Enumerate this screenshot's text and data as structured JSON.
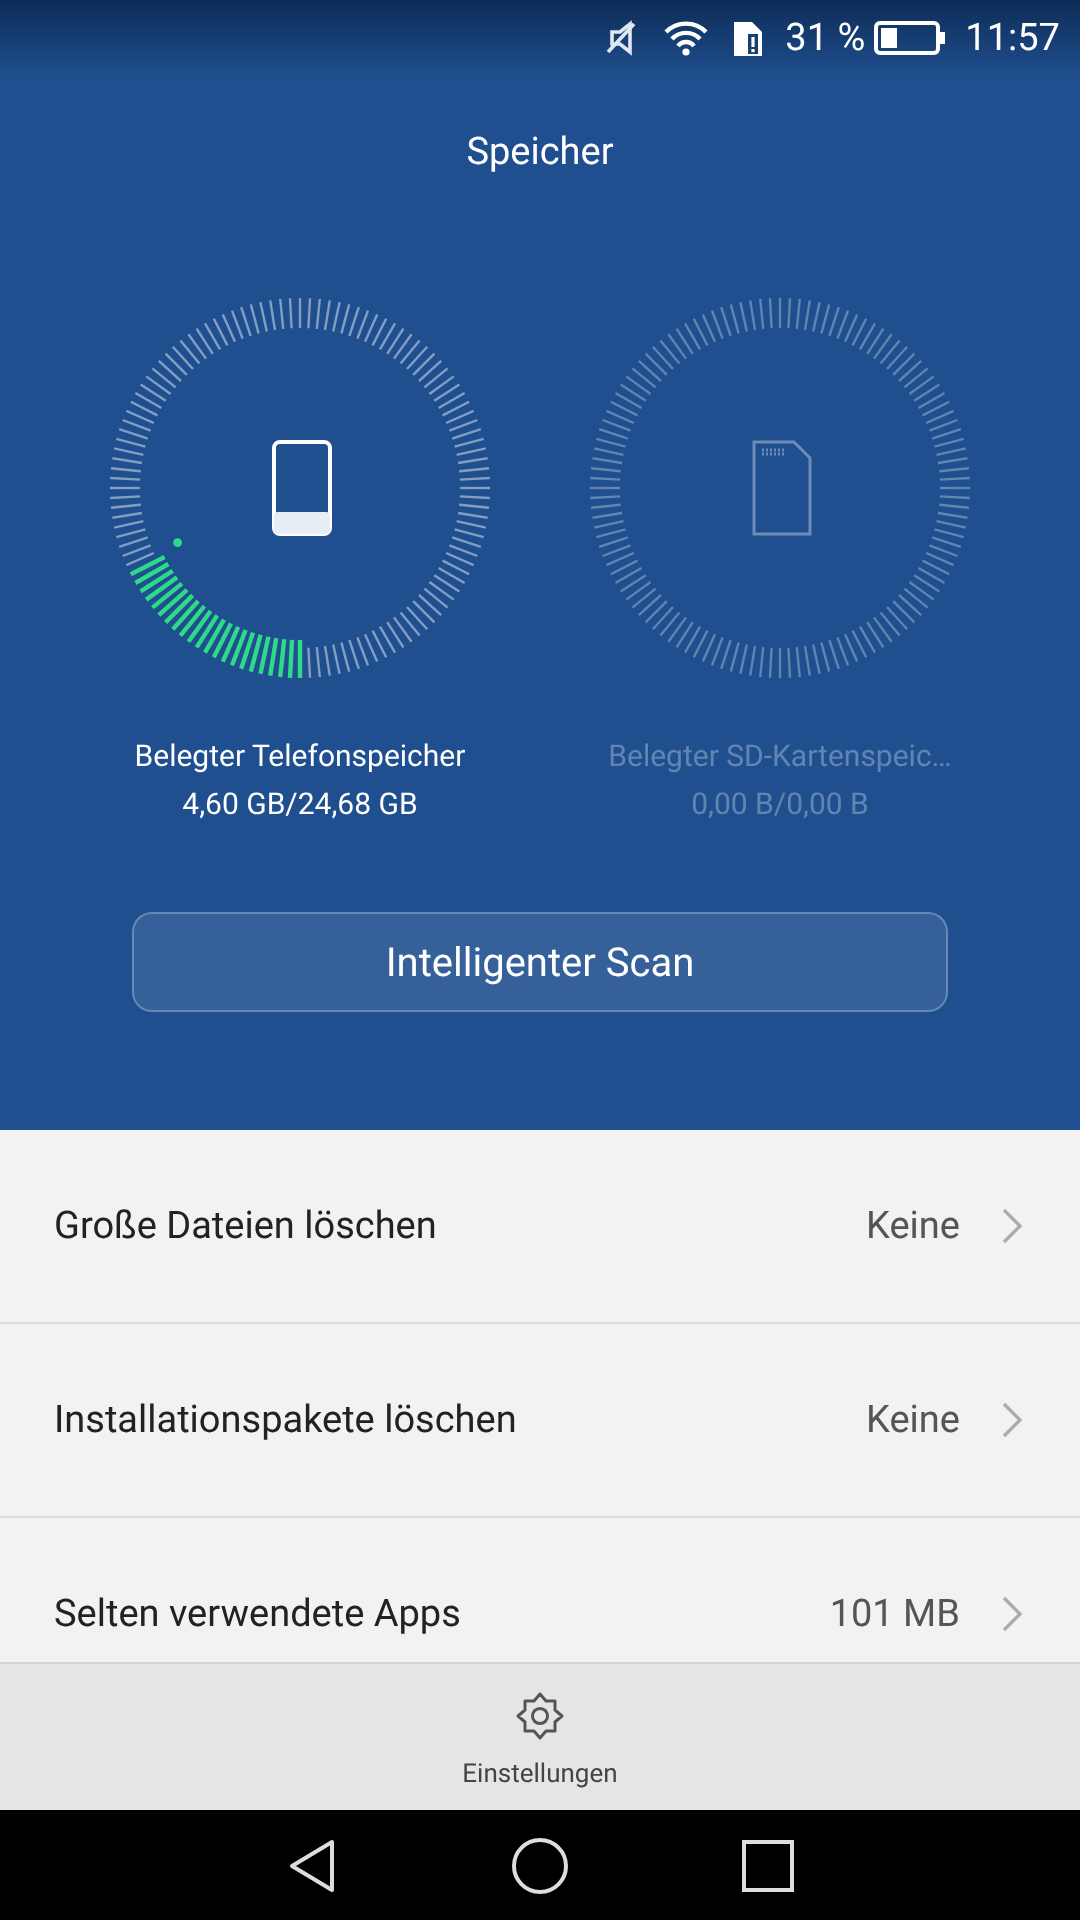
{
  "status_bar": {
    "battery": "31 %",
    "time": "11:57"
  },
  "title": "Speicher",
  "gauges": [
    {
      "kind": "phone",
      "label": "Belegter Telefonspeicher",
      "value": "4,60 GB/24,68 GB",
      "disabled": false
    },
    {
      "kind": "sd",
      "label": "Belegter SD-Kartenspeic…",
      "value": "0,00 B/0,00 B",
      "disabled": true
    }
  ],
  "scan_button": "Intelligenter Scan",
  "items": [
    {
      "label": "Große Dateien löschen",
      "value": "Keine"
    },
    {
      "label": "Installationspakete löschen",
      "value": "Keine"
    },
    {
      "label": "Selten verwendete Apps",
      "value": "101 MB"
    }
  ],
  "bottom_tab": "Einstellungen"
}
